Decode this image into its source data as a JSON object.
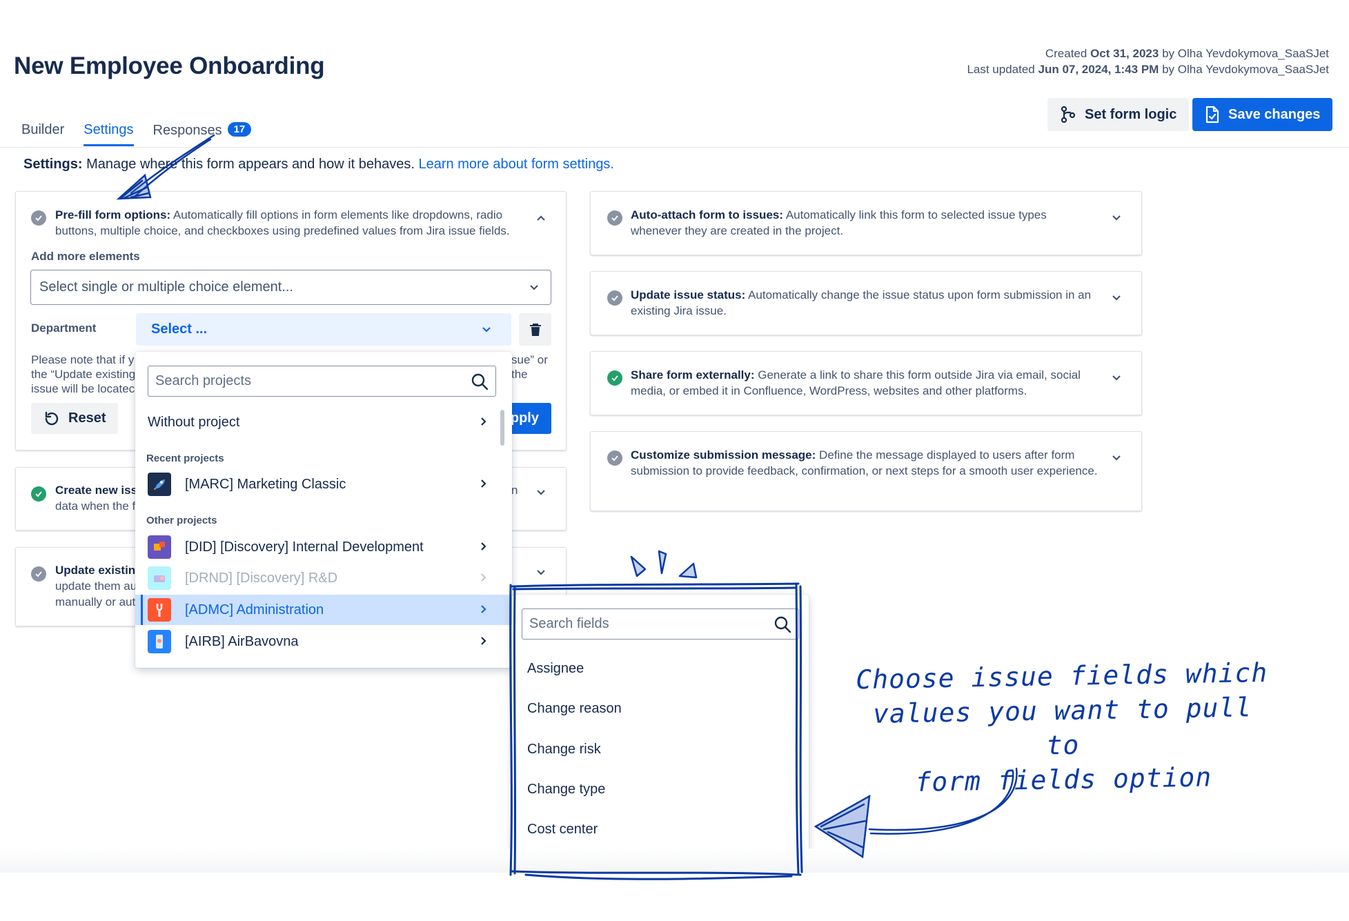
{
  "header": {
    "title": "New Employee Onboarding",
    "created_prefix": "Created",
    "created_date": "Oct 31, 2023",
    "created_by": "by Olha Yevdokymova_SaaSJet",
    "updated_prefix": "Last updated",
    "updated_date": "Jun 07, 2024, 1:43 PM",
    "updated_by": "by Olha Yevdokymova_SaaSJet"
  },
  "tabs": [
    {
      "label": "Builder"
    },
    {
      "label": "Settings"
    },
    {
      "label": "Responses",
      "badge": "17"
    }
  ],
  "actions": {
    "logic_label": "Set form logic",
    "save_label": "Save changes"
  },
  "intro": {
    "bold": "Settings:",
    "text": " Manage where this form appears and how it behaves. ",
    "link": "Learn more about form settings."
  },
  "prefill": {
    "title": "Pre-fill form options:",
    "desc": " Automatically fill options in form elements like dropdowns, radio buttons, multiple choice, and checkboxes using predefined values from Jira issue fields.",
    "add_label": "Add more elements",
    "element_placeholder": "Select single or multiple choice element...",
    "dept_label": "Department",
    "dept_value": "Select ...",
    "note_l1": "Please note that if y",
    "note_l2": "the “Update existing",
    "note_l3": "issue will be locatec",
    "note_r1": "sue” or",
    "note_r2": "the",
    "reset_label": "Reset",
    "apply_label": "pply"
  },
  "left_cards": [
    {
      "title": "Create new issu",
      "line2": "data when the f",
      "right": "n"
    },
    {
      "title": "Update existing",
      "line2": "update them au",
      "line3": "manually or aut"
    }
  ],
  "right_cards": [
    {
      "title": "Auto-attach form to issues:",
      "desc": " Automatically link this form to selected issue types whenever they are created in the project.",
      "status": "gray"
    },
    {
      "title": "Update issue status:",
      "desc": " Automatically change the issue status upon form submission in an existing Jira issue.",
      "status": "gray"
    },
    {
      "title": "Share form externally:",
      "desc": " Generate a link to share this form outside Jira via email, social media, or embed it in Confluence, WordPress, websites and other platforms.",
      "status": "green"
    },
    {
      "title": "Customize submission message:",
      "desc": " Define the message displayed to users after form submission to provide feedback, confirmation, or next steps for a smooth user experience.",
      "status": "gray"
    }
  ],
  "project_dropdown": {
    "search_placeholder": "Search projects",
    "without_project": "Without project",
    "recent_label": "Recent projects",
    "other_label": "Other projects",
    "recent": [
      {
        "label": "[MARC] Marketing Classic",
        "color": "#1d2f4f"
      }
    ],
    "other": [
      {
        "label": "[DID] [Discovery] Internal Development",
        "color": "#6554c0"
      },
      {
        "label": "[DRND] [Discovery] R&D",
        "color": "#79e2f2",
        "disabled": true
      },
      {
        "label": "[ADMC] Administration",
        "color": "#ff5630",
        "selected": true
      },
      {
        "label": "[AIRB] AirBavovna",
        "color": "#2684ff"
      }
    ]
  },
  "fields_dropdown": {
    "search_placeholder": "Search fields",
    "items": [
      "Assignee",
      "Change reason",
      "Change risk",
      "Change type",
      "Cost center"
    ]
  },
  "annotation": {
    "line1": "Choose issue fields which",
    "line2": "values you want to pull to",
    "line3": "form fields option"
  },
  "colors": {
    "brand_blue": "#0c66e4",
    "success_green": "#22a06b",
    "annotation_ink": "#0a3aa3"
  }
}
